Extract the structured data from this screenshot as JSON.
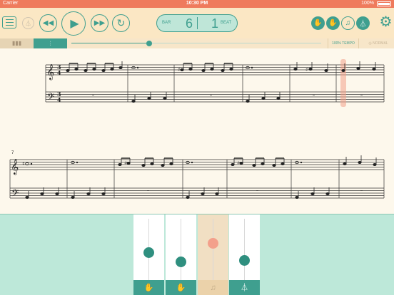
{
  "status_bar": {
    "carrier": "Carrier",
    "time": "10:30 PM",
    "battery": "100%"
  },
  "toolbar": {
    "bar_label": "BAR",
    "bar_value": "6",
    "beat_label": "BEAT",
    "beat_value": "1"
  },
  "secondary_bar": {
    "tempo_label": "100% TEMPO",
    "normal_label": "NORMAL",
    "position_fraction": 0.31
  },
  "score": {
    "system2_measure_number": "7"
  },
  "mixer": {
    "tracks": [
      {
        "icon": "right-hand-icon",
        "glyph": "✋",
        "level": 0.45,
        "enabled": true
      },
      {
        "icon": "left-hand-icon",
        "glyph": "✋",
        "level": 0.3,
        "enabled": true
      },
      {
        "icon": "music-note-icon",
        "glyph": "♫",
        "level": 0.6,
        "enabled": false
      },
      {
        "icon": "metronome-icon",
        "glyph": "⏃",
        "level": 0.32,
        "enabled": true
      }
    ]
  },
  "colors": {
    "accent": "#3f9f8f",
    "status_bar": "#ef7b5d",
    "toolbar_bg": "#fbe7c4",
    "panel_bg": "#bde8d9",
    "playhead": "#f3a08b"
  }
}
